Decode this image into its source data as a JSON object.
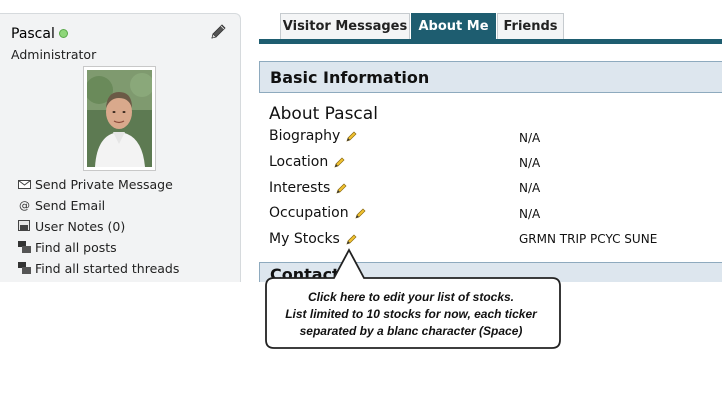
{
  "profile": {
    "name": "Pascal",
    "role": "Administrator",
    "status_color": "#8fd67a",
    "avatar_icon": "user-photo"
  },
  "sidebar": {
    "links": [
      {
        "label": "Send Private Message",
        "icon": "envelope-icon"
      },
      {
        "label": "Send Email",
        "icon": "at-icon"
      },
      {
        "label": "User Notes (0)",
        "icon": "notes-icon"
      },
      {
        "label": "Find all posts",
        "icon": "posts-icon"
      },
      {
        "label": "Find all started threads",
        "icon": "threads-icon"
      }
    ]
  },
  "tabs": [
    {
      "label": "Visitor Messages",
      "active": false
    },
    {
      "label": "About Me",
      "active": true
    },
    {
      "label": "Friends",
      "active": false
    }
  ],
  "colors": {
    "accent": "#1e5d70",
    "header_bg": "#dde6ee"
  },
  "basic_info": {
    "header": "Basic Information",
    "title": "About Pascal",
    "rows": [
      {
        "label": "Biography",
        "value": "N/A"
      },
      {
        "label": "Location",
        "value": "N/A"
      },
      {
        "label": "Interests",
        "value": "N/A"
      },
      {
        "label": "Occupation",
        "value": "N/A"
      },
      {
        "label": "My Stocks",
        "value": "GRMN TRIP PCYC SUNE"
      }
    ]
  },
  "contact": {
    "header": "Contact"
  },
  "callout": {
    "line1": "Click here to edit your list of stocks.",
    "line2": "List limited to 10 stocks for now, each ticker",
    "line3": "separated by a blanc character (Space)"
  }
}
